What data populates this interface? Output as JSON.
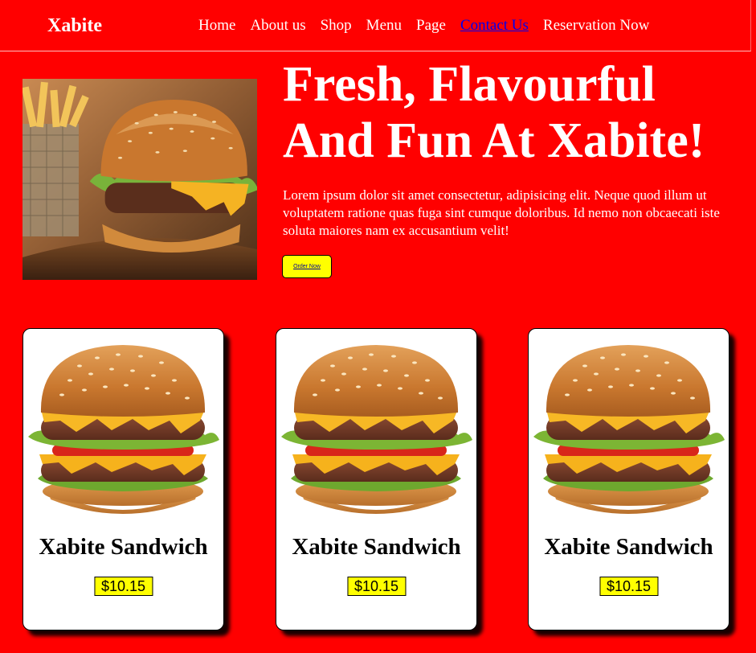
{
  "nav": {
    "brand": "Xabite",
    "links": [
      {
        "label": "Home"
      },
      {
        "label": "About us"
      },
      {
        "label": "Shop"
      },
      {
        "label": "Menu"
      },
      {
        "label": "Page"
      },
      {
        "label": "Contact Us"
      },
      {
        "label": "Reservation Now"
      }
    ]
  },
  "hero": {
    "title_line1": "Fresh, Flavourful",
    "title_line2": "And Fun At Xabite!",
    "text": "Lorem ipsum dolor sit amet consectetur, adipisicing elit. Neque quod illum ut voluptatem ratione quas fuga sint cumque doloribus. Id nemo non obcaecati iste soluta maiores nam ex accusantium velit!",
    "button_label": "Order Now"
  },
  "cards": [
    {
      "title": "Xabite Sandwich",
      "price": "$10.15"
    },
    {
      "title": "Xabite Sandwich",
      "price": "$10.15"
    },
    {
      "title": "Xabite Sandwich",
      "price": "$10.15"
    }
  ],
  "colors": {
    "background": "#ff0000",
    "button": "#ffff00",
    "active_link": "#0000ee",
    "card": "#ffffff"
  }
}
